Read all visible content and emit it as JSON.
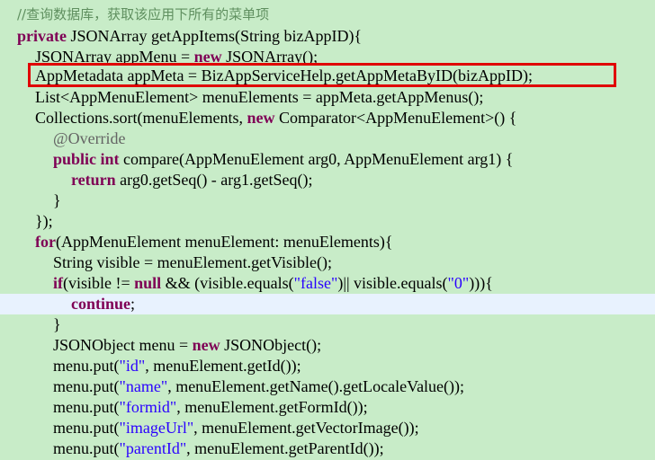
{
  "code": {
    "comment": "//查询数据库，获取该应用下所有的菜单项",
    "line1": {
      "kw": "private",
      "rest": " JSONArray getAppItems(String bizAppID){"
    },
    "line2": {
      "a": "JSONArray appMenu = ",
      "kw": "new",
      "b": " JSONArray();"
    },
    "line3": "AppMetadata appMeta = BizAppServiceHelp.getAppMetaByID(bizAppID);",
    "line4": "List<AppMenuElement> menuElements = appMeta.getAppMenus();",
    "line5": {
      "a": "Collections.sort(menuElements, ",
      "kw": "new",
      "b": " Comparator<AppMenuElement>() {"
    },
    "line6": "@Override",
    "line7": {
      "kw": "public int",
      "rest": " compare(AppMenuElement arg0, AppMenuElement arg1) {"
    },
    "line8": {
      "kw": "return",
      "rest": " arg0.getSeq() - arg1.getSeq();"
    },
    "line9": "}",
    "line10": "});",
    "line11": {
      "kw": "for",
      "rest": "(AppMenuElement menuElement: menuElements){"
    },
    "line12": "String visible = menuElement.getVisible();",
    "line13": {
      "kw1": "if",
      "a": "(visible != ",
      "kw2": "null",
      "b": " && (visible.equals(",
      "s1": "\"false\"",
      "c": ")|| visible.equals(",
      "s2": "\"0\"",
      "d": "))){"
    },
    "line14": {
      "kw": "continue",
      "rest": ";"
    },
    "line15": "}",
    "line16": {
      "a": "JSONObject menu = ",
      "kw": "new",
      "b": " JSONObject();"
    },
    "line17": {
      "a": "menu.put(",
      "s": "\"id\"",
      "b": ", menuElement.getId());"
    },
    "line18": {
      "a": "menu.put(",
      "s": "\"name\"",
      "b": ", menuElement.getName().getLocaleValue());"
    },
    "line19": {
      "a": "menu.put(",
      "s": "\"formid\"",
      "b": ", menuElement.getFormId());"
    },
    "line20": {
      "a": "menu.put(",
      "s": "\"imageUrl\"",
      "b": ", menuElement.getVectorImage());"
    },
    "line21": {
      "a": "menu.put(",
      "s": "\"parentId\"",
      "b": ", menuElement.getParentId());"
    }
  },
  "colors": {
    "background": "#c8ecc8",
    "keyword": "#7f0055",
    "string": "#2a00ff",
    "comment": "#5f8f5f",
    "highlight_border": "#e00000",
    "current_line": "#e8f2fe"
  }
}
